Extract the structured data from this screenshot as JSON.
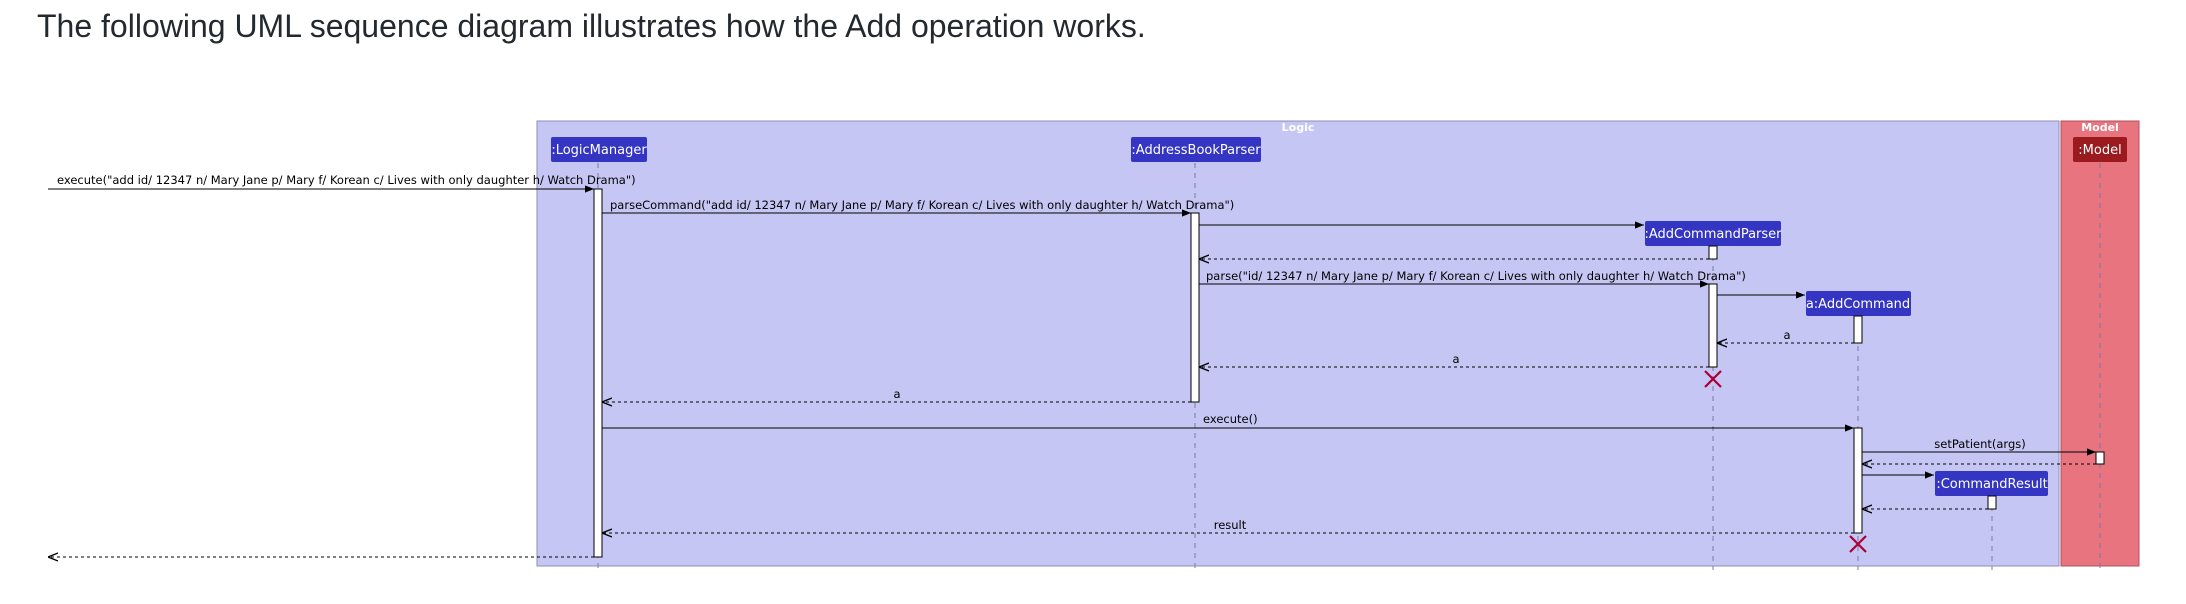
{
  "heading": "The following UML sequence diagram illustrates how the Add operation works.",
  "colors": {
    "logic_box": "#C6C6F4",
    "logic_border": "#8D8DB8",
    "model_box": "#E8747F",
    "model_border": "#B0505C",
    "participant": "#3535C3",
    "model_participant": "#9A1A1E",
    "activation": "#ffffff"
  },
  "groups": {
    "logic": "Logic",
    "model": "Model"
  },
  "participants": {
    "logic_manager": ":LogicManager",
    "address_book_parser": ":AddressBookParser",
    "add_command_parser": ":AddCommandParser",
    "add_command": "a:AddCommand",
    "command_result": ":CommandResult",
    "model": ":Model"
  },
  "messages": {
    "execute_call": "execute(\"add id/ 12347 n/ Mary Jane p/ Mary f/ Korean c/ Lives with only daughter h/ Watch Drama\")",
    "parse_command": "parseCommand(\"add id/ 12347 n/ Mary Jane p/ Mary f/ Korean c/ Lives with only daughter h/ Watch Drama\")",
    "parse": "parse(\"id/ 12347 n/ Mary Jane p/ Mary f/ Korean c/ Lives with only daughter h/ Watch Drama\")",
    "return_a_1": "a",
    "return_a_2": "a",
    "return_a_3": "a",
    "execute": "execute()",
    "set_patient": "setPatient(args)",
    "result": "result"
  }
}
